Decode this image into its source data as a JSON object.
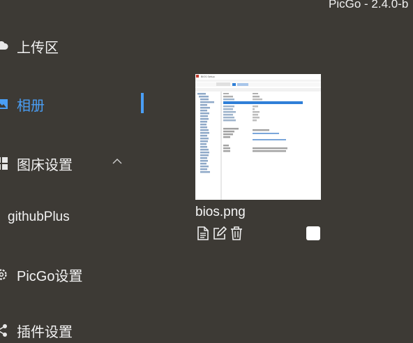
{
  "app": {
    "title": "PicGo - 2.4.0-b"
  },
  "sidebar": {
    "items": [
      {
        "label": "上传区",
        "icon": "cloud-icon"
      },
      {
        "label": "相册",
        "icon": "image-icon",
        "active": true
      },
      {
        "label": "图床设置",
        "icon": "grid-icon",
        "expanded": true
      },
      {
        "label": "PicGo设置",
        "icon": "gear-icon"
      },
      {
        "label": "插件设置",
        "icon": "share-icon"
      }
    ],
    "sub_items": [
      {
        "label": "githubPlus"
      }
    ]
  },
  "gallery": {
    "items": [
      {
        "filename": "bios.png",
        "thumbnail_title": "BIOS Setup",
        "selected": false
      }
    ]
  },
  "colors": {
    "background": "#3d3a35",
    "accent": "#4a9ef5",
    "text": "#f2f2f2"
  }
}
